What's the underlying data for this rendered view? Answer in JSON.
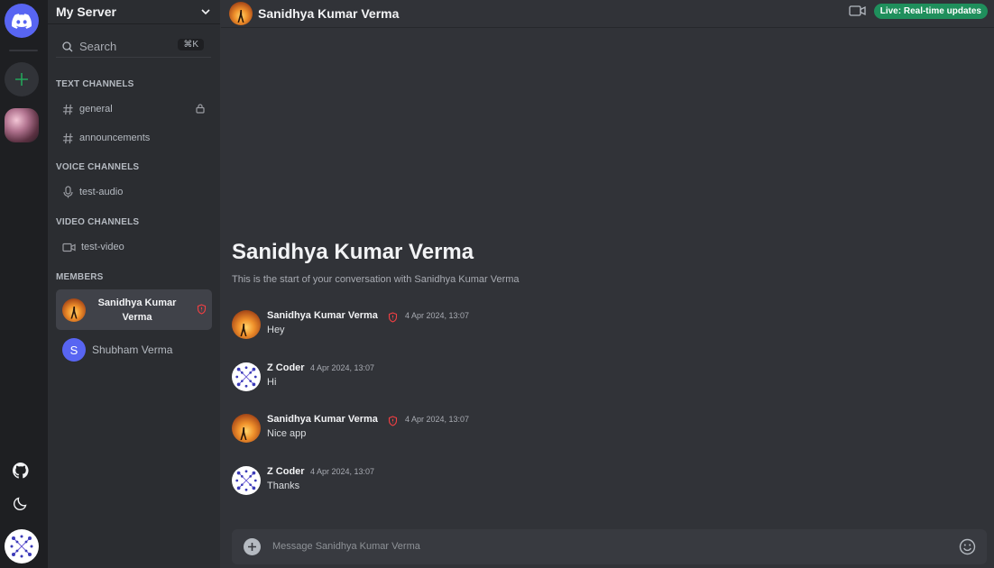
{
  "server": {
    "name": "My Server",
    "search_label": "Search",
    "search_shortcut": "⌘K"
  },
  "sections": {
    "text": "TEXT CHANNELS",
    "voice": "VOICE CHANNELS",
    "video": "VIDEO CHANNELS",
    "members": "MEMBERS"
  },
  "channels": {
    "text": [
      {
        "name": "general",
        "locked": true,
        "icon": "hash-icon"
      },
      {
        "name": "announcements",
        "locked": false,
        "icon": "hash-icon"
      }
    ],
    "voice": [
      {
        "name": "test-audio",
        "icon": "mic-icon"
      }
    ],
    "video": [
      {
        "name": "test-video",
        "icon": "video-icon"
      }
    ]
  },
  "members": [
    {
      "name": "Sanidhya Kumar Verma",
      "active": true,
      "role_icon": "shield-alert-icon"
    },
    {
      "name": "Shubham Verma",
      "initial": "S",
      "active": false
    }
  ],
  "chat": {
    "title": "Sanidhya Kumar Verma",
    "live_badge": "Live: Real-time updates",
    "welcome_title": "Sanidhya Kumar Verma",
    "welcome_sub": "This is the start of your conversation with Sanidhya Kumar Verma",
    "messages": [
      {
        "author": "Sanidhya Kumar Verma",
        "time": "4 Apr 2024, 13:07",
        "text": "Hey",
        "admin": true
      },
      {
        "author": "Z Coder",
        "time": "4 Apr 2024, 13:07",
        "text": "Hi",
        "admin": false
      },
      {
        "author": "Sanidhya Kumar Verma",
        "time": "4 Apr 2024, 13:07",
        "text": "Nice app",
        "admin": true
      },
      {
        "author": "Z Coder",
        "time": "4 Apr 2024, 13:07",
        "text": "Thanks",
        "admin": false
      }
    ],
    "composer_placeholder": "Message Sanidhya Kumar Verma"
  },
  "colors": {
    "accent": "#5865f2",
    "live": "#1f8f5c",
    "add": "#23a55a",
    "alert": "#f23f43"
  }
}
